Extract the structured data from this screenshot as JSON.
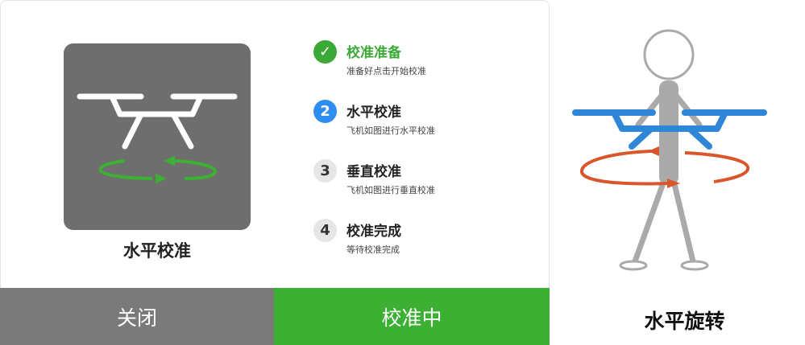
{
  "preview": {
    "caption": "水平校准"
  },
  "steps": [
    {
      "badge": "✓",
      "title": "校准准备",
      "desc": "准备好点击开始校准",
      "state": "done"
    },
    {
      "badge": "2",
      "title": "水平校准",
      "desc": "飞机如图进行水平校准",
      "state": "active"
    },
    {
      "badge": "3",
      "title": "垂直校准",
      "desc": "飞机如图进行垂直校准",
      "state": "pending"
    },
    {
      "badge": "4",
      "title": "校准完成",
      "desc": "等待校准完成",
      "state": "pending"
    }
  ],
  "buttons": {
    "close_label": "关闭",
    "calibrate_label": "校准中"
  },
  "illustration": {
    "caption": "水平旋转"
  },
  "colors": {
    "accent_green": "#3cb033",
    "active_blue": "#2e8ef0",
    "drone_blue": "#2f86d6",
    "rotation_orange": "#d9562a"
  },
  "icons": {
    "preview": "drone-horizontal-rotation-icon",
    "done": "check-icon",
    "illustration": "person-holding-drone-icon"
  }
}
